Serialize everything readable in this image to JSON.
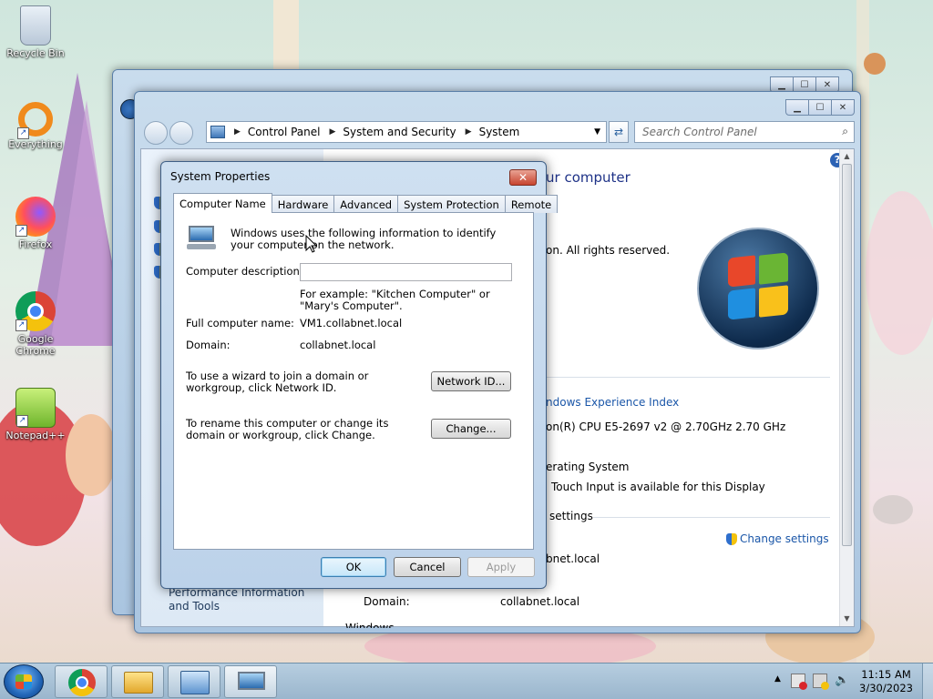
{
  "desktop": {
    "icons": [
      {
        "label": "Recycle Bin",
        "icon": "recycle-bin-icon"
      },
      {
        "label": "Everything",
        "icon": "everything-icon"
      },
      {
        "label": "Firefox",
        "icon": "firefox-icon"
      },
      {
        "label": "Google Chrome",
        "icon": "chrome-icon"
      },
      {
        "label": "Notepad++",
        "icon": "notepadpp-icon"
      }
    ]
  },
  "explorer": {
    "breadcrumb": [
      "Control Panel",
      "System and Security",
      "System"
    ],
    "search_placeholder": "Search Control Panel",
    "heading_partial": "ur computer",
    "copyright_partial": "on.  All rights reserved.",
    "experience_link": "ndows Experience Index",
    "processor_partial": "on(R) CPU E5-2697 v2 @ 2.70GHz   2.70 GHz",
    "os_partial": "erating System",
    "touch_partial": "Touch Input is available for this Display",
    "settings_partial": "settings",
    "change_settings": "Change settings",
    "domain_partial": "bnet.local",
    "domain_label": "Domain:",
    "domain_value": "collabnet.local",
    "left_nav_partial": "Performance Information and Tools",
    "activation_partial": "Windows activation"
  },
  "dialog": {
    "title": "System Properties",
    "tabs": [
      "Computer Name",
      "Hardware",
      "Advanced",
      "System Protection",
      "Remote"
    ],
    "active_tab": "Computer Name",
    "intro": "Windows uses the following information to identify your computer on the network.",
    "description_label": "Computer description:",
    "description_value": "",
    "example": "For example: \"Kitchen Computer\" or \"Mary's Computer\".",
    "full_name_label": "Full computer name:",
    "full_name_value": "VM1.collabnet.local",
    "domain_label": "Domain:",
    "domain_value": "collabnet.local",
    "network_text": "To use a wizard to join a domain or workgroup, click Network ID.",
    "network_button": "Network ID...",
    "rename_text": "To rename this computer or change its domain or workgroup, click Change.",
    "change_button": "Change...",
    "ok": "OK",
    "cancel": "Cancel",
    "apply": "Apply"
  },
  "taskbar": {
    "time": "11:15 AM",
    "date": "3/30/2023"
  }
}
